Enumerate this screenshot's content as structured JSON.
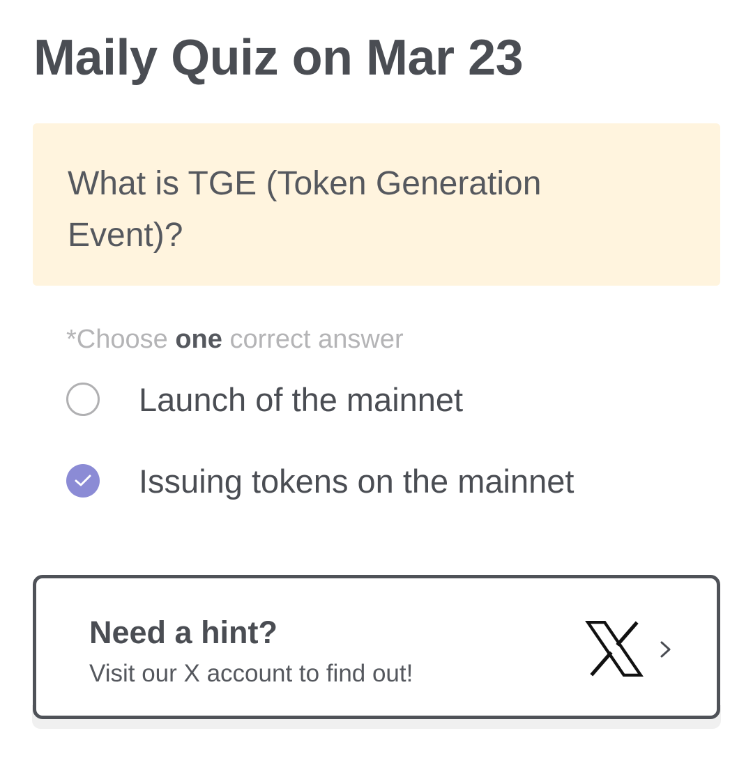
{
  "quiz": {
    "title": "Maily Quiz on Mar 23",
    "question": "What is TGE (Token Generation Event)?",
    "instruction": {
      "prefix": "*Choose ",
      "emphasis": "one",
      "suffix": " correct answer"
    },
    "options": [
      {
        "label": "Launch of the mainnet",
        "selected": false
      },
      {
        "label": "Issuing tokens on the mainnet",
        "selected": true
      }
    ]
  },
  "hint": {
    "title": "Need a hint?",
    "subtitle": "Visit our X account to find out!",
    "logo_icon": "x-logo-icon",
    "arrow_icon": "chevron-right-icon"
  },
  "colors": {
    "text_primary": "#4a4d53",
    "question_background": "#fff4de",
    "instruction_muted": "#b4b4b6",
    "selected_accent": "#8b8bd5",
    "card_border": "#4f5258"
  }
}
